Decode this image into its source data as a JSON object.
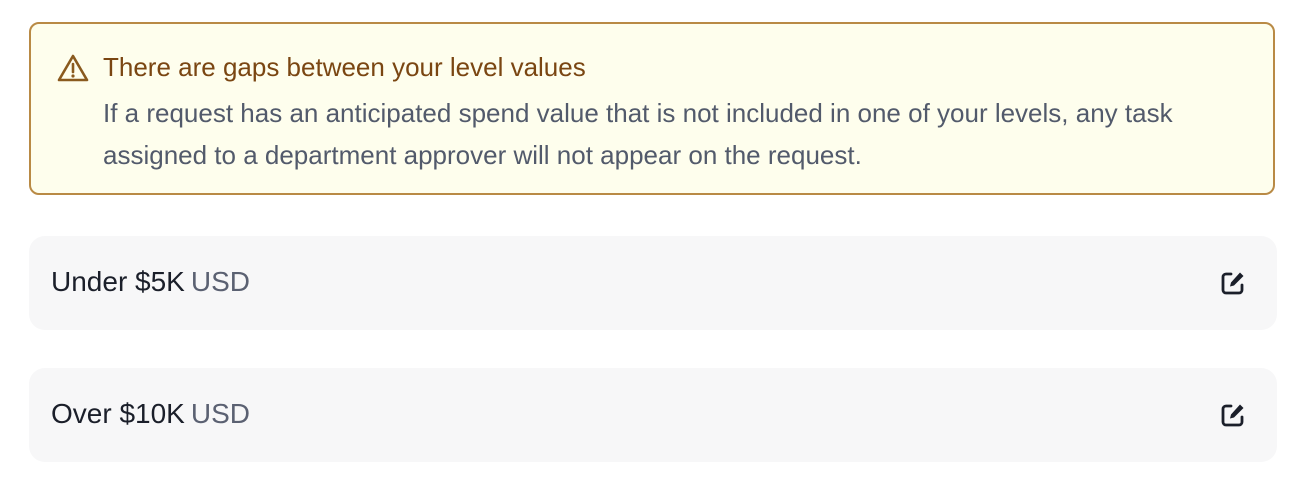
{
  "warning": {
    "icon": "warning-triangle-icon",
    "title": "There are gaps between your level values",
    "body": "If a request has an anticipated spend value that is not included in one of your levels, any task assigned to a department approver will not appear on the request.",
    "colors": {
      "background": "#fefeed",
      "border": "#b98a45",
      "title": "#7a4612"
    }
  },
  "levels": [
    {
      "amount": "Under $5K",
      "currency": "USD",
      "edit_icon": "edit-icon"
    },
    {
      "amount": "Over $10K",
      "currency": "USD",
      "edit_icon": "edit-icon"
    }
  ]
}
